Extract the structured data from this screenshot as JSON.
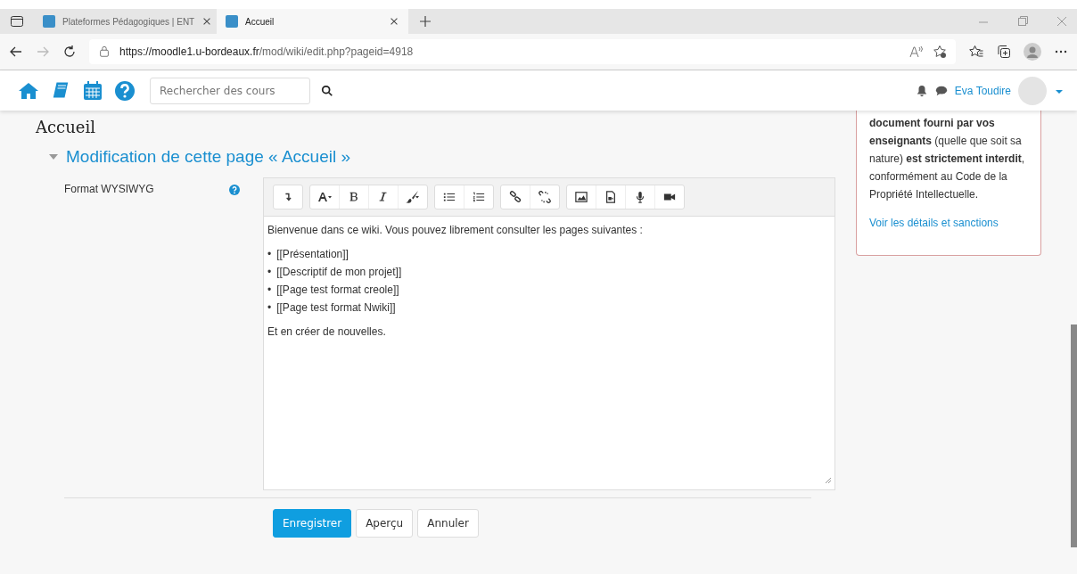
{
  "browser": {
    "tabs": [
      {
        "title": "Plateformes Pédagogiques | ENT",
        "selected": false
      },
      {
        "title": "Accueil",
        "selected": true
      }
    ],
    "url_host": "https://moodle1.u-bordeaux.fr",
    "url_path": "/mod/wiki/edit.php?pageid=4918"
  },
  "navbar": {
    "search": {
      "placeholder": "Rechercher des cours"
    },
    "user_name": "Eva Toudire"
  },
  "page_title": "Accueil",
  "section": {
    "title": "Modification de cette page « Accueil »",
    "expanded": true
  },
  "editor": {
    "label": "Format WYSIWYG",
    "content": [
      {
        "kind": "paragraph",
        "text": "Bienvenue dans ce wiki. Vous pouvez librement consulter les pages suivantes :"
      },
      {
        "kind": "list",
        "bullet": "•",
        "items": [
          "[[Présentation]]",
          "[[Descriptif de mon projet]]",
          "[[Page test format creole]]",
          "[[Page test format Nwiki]]"
        ]
      },
      {
        "kind": "paragraph",
        "text": "Et en créer de nouvelles."
      }
    ]
  },
  "buttons": [
    {
      "label": "Enregistrer",
      "kind": "primary"
    },
    {
      "label": "Aperçu",
      "kind": "secondary"
    },
    {
      "label": "Annuler",
      "kind": "secondary"
    }
  ],
  "notice": {
    "text": "**document fourni par vos enseignants** (quelle que soit sa nature) **est strictement interdit**, conformément au Code de la Propriété Intellectuelle.",
    "link": "Voir les détails et sanctions"
  }
}
